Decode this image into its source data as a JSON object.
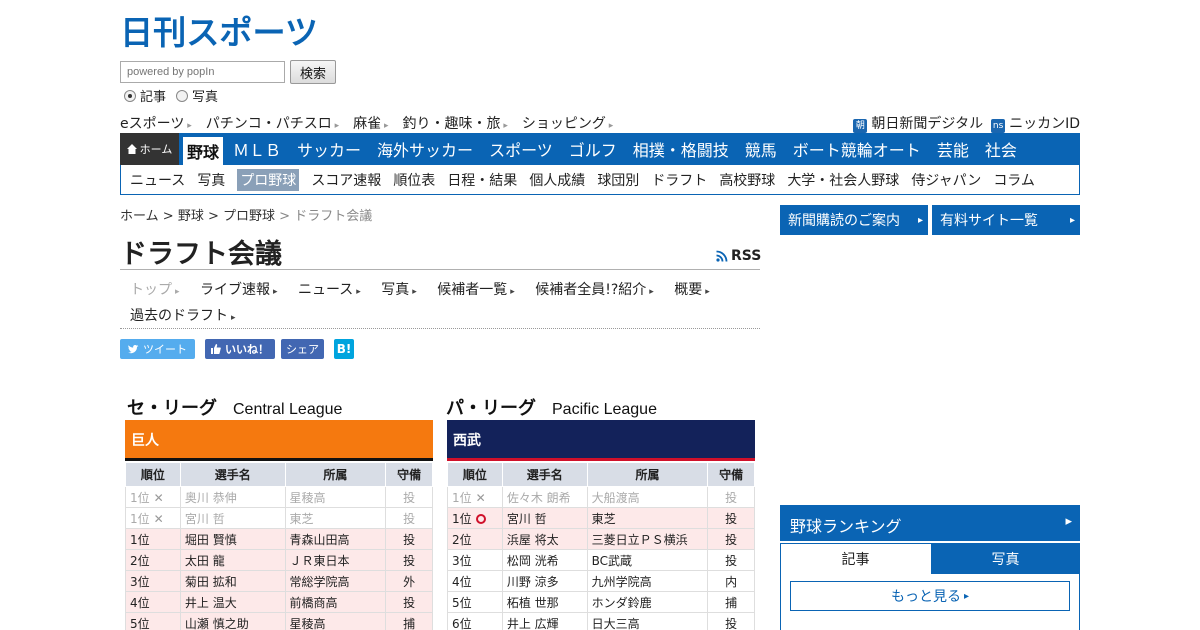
{
  "site": {
    "logo_text": "日刊スポーツ",
    "search_placeholder": "powered by popIn",
    "search_button": "検索",
    "radio_articles": "記事",
    "radio_photos": "写真"
  },
  "sub_links": [
    "eスポーツ",
    "パチンコ・パチスロ",
    "麻雀",
    "釣り・趣味・旅",
    "ショッピング"
  ],
  "sub_right": {
    "asahi_icon": "朝",
    "asahi": "朝日新聞デジタル",
    "nikkan_icon": "ns",
    "nikkan_id": "ニッカンID"
  },
  "global_nav": {
    "home": "ホーム",
    "items": [
      "野球",
      "ＭＬＢ",
      "サッカー",
      "海外サッカー",
      "スポーツ",
      "ゴルフ",
      "相撲・格闘技",
      "競馬",
      "ボート競輪オート",
      "芸能",
      "社会"
    ]
  },
  "local_nav": [
    "ニュース",
    "写真",
    "プロ野球",
    "スコア速報",
    "順位表",
    "日程・結果",
    "個人成績",
    "球団別",
    "ドラフト",
    "高校野球",
    "大学・社会人野球",
    "侍ジャパン",
    "コラム"
  ],
  "breadcrumb": {
    "home": "ホーム",
    "baseball": "野球",
    "pro": "プロ野球",
    "current": "ドラフト会議",
    "sep": ">"
  },
  "page_title": "ドラフト会議",
  "rss": "RSS",
  "tabs": {
    "top": "トップ",
    "items": [
      "ライブ速報",
      "ニュース",
      "写真",
      "候補者一覧",
      "候補者全員!?紹介",
      "概要"
    ],
    "past": "過去のドラフト"
  },
  "share": {
    "tweet": "ツイート",
    "like": "いいね！",
    "share": "シェア",
    "hatena": "B!"
  },
  "central": {
    "jp": "セ・リーグ",
    "en": "Central League",
    "team": "巨人",
    "headers": [
      "順位",
      "選手名",
      "所属",
      "守備"
    ],
    "rows": [
      {
        "rank": "1位",
        "mark": "x",
        "name": "奥川 恭伸",
        "team": "星稜高",
        "pos": "投",
        "style": "gray"
      },
      {
        "rank": "1位",
        "mark": "x",
        "name": "宮川 哲",
        "team": "東芝",
        "pos": "投",
        "style": "gray"
      },
      {
        "rank": "1位",
        "mark": "",
        "name": "堀田 賢慎",
        "team": "青森山田高",
        "pos": "投",
        "style": "pink"
      },
      {
        "rank": "2位",
        "mark": "",
        "name": "太田 龍",
        "team": "ＪＲ東日本",
        "pos": "投",
        "style": "pink"
      },
      {
        "rank": "3位",
        "mark": "",
        "name": "菊田 拡和",
        "team": "常総学院高",
        "pos": "外",
        "style": "pink"
      },
      {
        "rank": "4位",
        "mark": "",
        "name": "井上 温大",
        "team": "前橋商高",
        "pos": "投",
        "style": "pink"
      },
      {
        "rank": "5位",
        "mark": "",
        "name": "山瀬 慎之助",
        "team": "星稜高",
        "pos": "捕",
        "style": "pink"
      }
    ]
  },
  "pacific": {
    "jp": "パ・リーグ",
    "en": "Pacific League",
    "team": "西武",
    "headers": [
      "順位",
      "選手名",
      "所属",
      "守備"
    ],
    "rows": [
      {
        "rank": "1位",
        "mark": "x",
        "name": "佐々木 朗希",
        "team": "大船渡高",
        "pos": "投",
        "style": "gray"
      },
      {
        "rank": "1位",
        "mark": "o",
        "name": "宮川 哲",
        "team": "東芝",
        "pos": "投",
        "style": "pink"
      },
      {
        "rank": "2位",
        "mark": "",
        "name": "浜屋 将太",
        "team": "三菱日立ＰＳ横浜",
        "pos": "投",
        "style": "pink"
      },
      {
        "rank": "3位",
        "mark": "",
        "name": "松岡 洸希",
        "team": "BC武蔵",
        "pos": "投",
        "style": "white"
      },
      {
        "rank": "4位",
        "mark": "",
        "name": "川野 涼多",
        "team": "九州学院高",
        "pos": "内",
        "style": "white"
      },
      {
        "rank": "5位",
        "mark": "",
        "name": "柘植 世那",
        "team": "ホンダ鈴鹿",
        "pos": "捕",
        "style": "white"
      },
      {
        "rank": "6位",
        "mark": "",
        "name": "井上 広輝",
        "team": "日大三高",
        "pos": "投",
        "style": "white"
      }
    ]
  },
  "right": {
    "subscribe": "新聞購読のご案内",
    "paid_sites": "有料サイト一覧",
    "ranking_title": "野球ランキング",
    "tab_articles": "記事",
    "tab_photos": "写真",
    "more": "もっと見る"
  },
  "colors": {
    "brand_blue": "#0a64b4",
    "giants_orange": "#f5790f",
    "seibu_navy": "#13225a"
  }
}
